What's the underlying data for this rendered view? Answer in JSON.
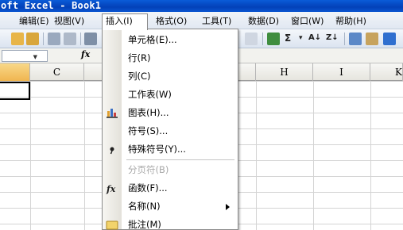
{
  "window": {
    "title": "oft Excel - Book1"
  },
  "menubar": {
    "items": [
      {
        "label": "编辑(E)",
        "key": "edit"
      },
      {
        "label": "视图(V)",
        "key": "view"
      },
      {
        "label": "插入(I)",
        "key": "insert",
        "active": true
      },
      {
        "label": "格式(O)",
        "key": "format"
      },
      {
        "label": "工具(T)",
        "key": "tools"
      },
      {
        "label": "数据(D)",
        "key": "data"
      },
      {
        "label": "窗口(W)",
        "key": "window"
      },
      {
        "label": "帮助(H)",
        "key": "help"
      }
    ]
  },
  "toolbar": {
    "sum_symbol": "Σ",
    "sort_asc": "A↓",
    "sort_desc": "Z↓"
  },
  "formula_bar": {
    "namebox_value": "",
    "fx_label": "fx"
  },
  "columns": [
    {
      "label": "",
      "key": "blank"
    },
    {
      "label": "C",
      "key": "c"
    },
    {
      "label": "H",
      "key": "h"
    },
    {
      "label": "I",
      "key": "i"
    },
    {
      "label": "K",
      "key": "k"
    }
  ],
  "insert_menu": {
    "items": [
      {
        "label": "单元格(E)...",
        "icon": ""
      },
      {
        "label": "行(R)",
        "icon": ""
      },
      {
        "label": "列(C)",
        "icon": ""
      },
      {
        "label": "工作表(W)",
        "icon": ""
      },
      {
        "label": "图表(H)...",
        "icon": "chart-icon"
      },
      {
        "label": "符号(S)...",
        "icon": ""
      },
      {
        "label": "特殊符号(Y)...",
        "icon": "special-symbol-icon"
      },
      {
        "label": "分页符(B)",
        "icon": "",
        "disabled": true
      },
      {
        "label": "函数(F)...",
        "icon": "function-icon"
      },
      {
        "label": "名称(N)",
        "icon": "",
        "submenu": true
      },
      {
        "label": "批注(M)",
        "icon": "comment-icon"
      }
    ]
  },
  "colors": {
    "title_bar": "#0a4fcf",
    "selected_column_header": "#f3c468",
    "menu_border": "#8a8a8a"
  }
}
